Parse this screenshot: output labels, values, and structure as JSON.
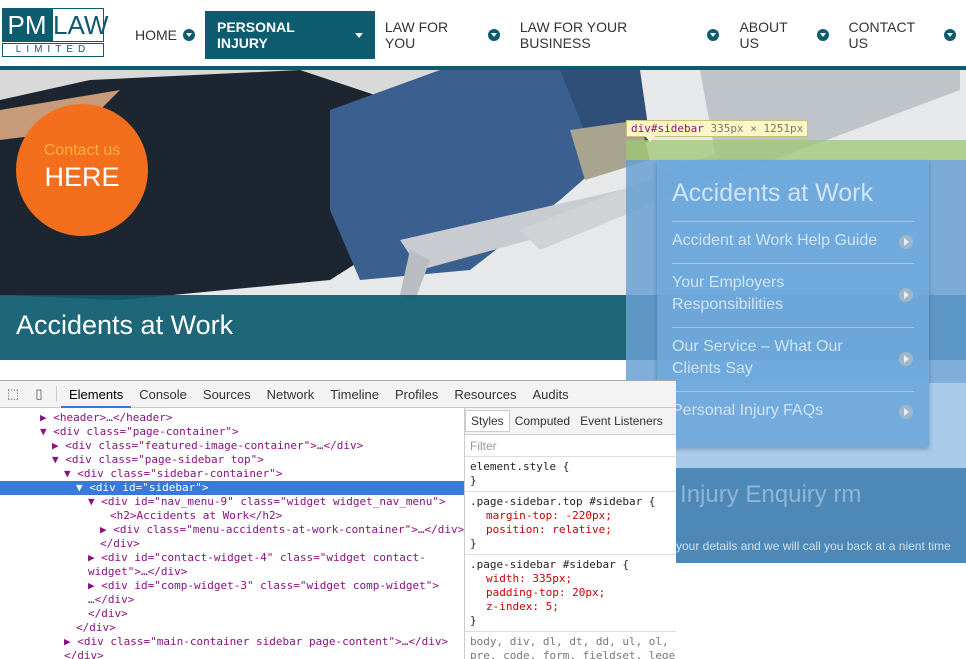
{
  "header": {
    "logo_pm": "PM",
    "logo_law": "LAW",
    "logo_limited": "LIMITED",
    "nav": [
      {
        "label": "HOME"
      },
      {
        "label": "PERSONAL INJURY"
      },
      {
        "label": "LAW FOR YOU"
      },
      {
        "label": "LAW FOR YOUR BUSINESS"
      },
      {
        "label": "ABOUT US"
      },
      {
        "label": "CONTACT US"
      }
    ]
  },
  "hero": {
    "contact_small": "Contact us",
    "contact_big": "HERE",
    "title": "Accidents at Work"
  },
  "sidebar": {
    "tooltip_tag": "div#sidebar",
    "tooltip_dims": "335px × 1251px",
    "title": "Accidents at Work",
    "links": [
      {
        "label": "Accident at Work Help Guide"
      },
      {
        "label": "Your Employers Responsibilities"
      },
      {
        "label": "Our Service – What Our Clients Say"
      },
      {
        "label": "Personal Injury FAQs"
      }
    ],
    "enquiry_title": "rsonal Injury Enquiry rm",
    "enquiry_sub": "your details and we will call you back at a nient time"
  },
  "devtools": {
    "tabs": [
      "Elements",
      "Console",
      "Sources",
      "Network",
      "Timeline",
      "Profiles",
      "Resources",
      "Audits"
    ],
    "tree": [
      {
        "text": "▶ <header>…</header>"
      },
      {
        "text": "▼ <div class=\"page-container\">"
      },
      {
        "text": "▶ <div class=\"featured-image-container\">…</div>"
      },
      {
        "text": "▼ <div class=\"page-sidebar top\">"
      },
      {
        "text": "▼ <div class=\"sidebar-container\">"
      },
      {
        "text": "▼ <div id=\"sidebar\">"
      },
      {
        "text": "▼ <div id=\"nav_menu-9\" class=\"widget widget_nav_menu\">"
      },
      {
        "text": "<h2>Accidents at Work</h2>"
      },
      {
        "text": "▶ <div class=\"menu-accidents-at-work-container\">…</div>"
      },
      {
        "text": "</div>"
      },
      {
        "text": "▶ <div id=\"contact-widget-4\" class=\"widget contact-"
      },
      {
        "text": "widget\">…</div>"
      },
      {
        "text": "▶ <div id=\"comp-widget-3\" class=\"widget comp-widget\">"
      },
      {
        "text": "…</div>"
      },
      {
        "text": "</div>"
      },
      {
        "text": "</div>"
      },
      {
        "text": "▶ <div class=\"main-container sidebar page-content\">…</div>"
      },
      {
        "text": "</div>"
      }
    ],
    "styles_tabs": [
      "Styles",
      "Computed",
      "Event Listeners"
    ],
    "filter_placeholder": "Filter",
    "rules": [
      {
        "selector": "element.style {",
        "props": [],
        "close": "}"
      },
      {
        "selector": ".page-sidebar.top #sidebar {",
        "props": [
          "margin-top: -220px;",
          "position: relative;"
        ],
        "close": "}"
      },
      {
        "selector": ".page-sidebar #sidebar {",
        "props": [
          "width: 335px;",
          "padding-top: 20px;",
          "z-index: 5;"
        ],
        "close": "}"
      }
    ],
    "inherit_1": "body, div, dl, dt, dd, ul, ol,",
    "inherit_2": "pre, code, form, fieldset, lege"
  }
}
